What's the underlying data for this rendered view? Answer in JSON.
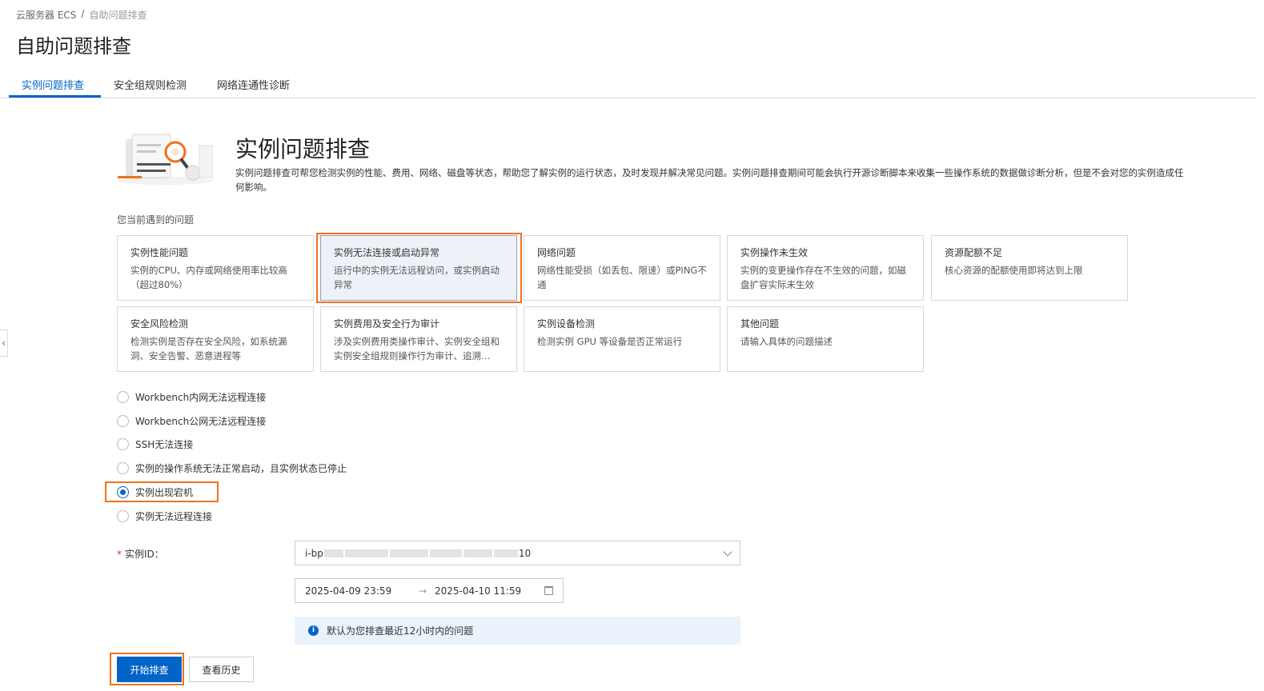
{
  "breadcrumb": {
    "parent": "云服务器 ECS",
    "separator": "/",
    "current": "自助问题排查"
  },
  "page_title": "自助问题排查",
  "tabs": [
    {
      "label": "实例问题排查",
      "active": true
    },
    {
      "label": "安全组规则检测",
      "active": false
    },
    {
      "label": "网络连通性诊断",
      "active": false
    }
  ],
  "hero": {
    "title": "实例问题排查",
    "description": "实例问题排查可帮您检测实例的性能、费用、网络、磁盘等状态，帮助您了解实例的运行状态，及时发现并解决常见问题。实例问题排查期间可能会执行开源诊断脚本来收集一些操作系统的数据做诊断分析，但是不会对您的实例造成任何影响。"
  },
  "problems_label": "您当前遇到的问题",
  "problem_cards": [
    {
      "title": "实例性能问题",
      "desc": "实例的CPU、内存或网络使用率比较高（超过80%）",
      "selected": false
    },
    {
      "title": "实例无法连接或启动异常",
      "desc": "运行中的实例无法远程访问，或实例启动异常",
      "selected": true
    },
    {
      "title": "网络问题",
      "desc": "网络性能受损（如丢包、限速）或PING不通",
      "selected": false
    },
    {
      "title": "实例操作未生效",
      "desc": "实例的变更操作存在不生效的问题，如磁盘扩容实际未生效",
      "selected": false
    },
    {
      "title": "资源配额不足",
      "desc": "核心资源的配额使用即将达到上限",
      "selected": false
    },
    {
      "title": "安全风险检测",
      "desc": "检测实例是否存在安全风险，如系统漏洞、安全告警、恶意进程等",
      "selected": false
    },
    {
      "title": "实例费用及安全行为审计",
      "desc": "涉及实例费用类操作审计、实例安全组和实例安全组规则操作行为审计、追溯…",
      "selected": false
    },
    {
      "title": "实例设备检测",
      "desc": "检测实例 GPU 等设备是否正常运行",
      "selected": false
    },
    {
      "title": "其他问题",
      "desc": "请输入具体的问题描述",
      "selected": false
    }
  ],
  "sub_options": [
    {
      "label": "Workbench内网无法远程连接",
      "checked": false
    },
    {
      "label": "Workbench公网无法远程连接",
      "checked": false
    },
    {
      "label": "SSH无法连接",
      "checked": false
    },
    {
      "label": "实例的操作系统无法正常启动，且实例状态已停止",
      "checked": false
    },
    {
      "label": "实例出现宕机",
      "checked": true
    },
    {
      "label": "实例无法远程连接",
      "checked": false
    }
  ],
  "instance": {
    "required_mark": "*",
    "label": "实例ID：",
    "value_prefix": "i-bp",
    "value_suffix": "10"
  },
  "time_range": {
    "start": "2025-04-09 23:59",
    "arrow": "→",
    "end": "2025-04-10 11:59"
  },
  "alert_text": "默认为您排查最近12小时内的问题",
  "buttons": {
    "start": "开始排查",
    "history": "查看历史"
  },
  "colors": {
    "primary": "#0064c8",
    "highlight": "#f0711e",
    "selected_card_bg": "#eef2f8",
    "alert_bg": "#eaf3fc"
  }
}
